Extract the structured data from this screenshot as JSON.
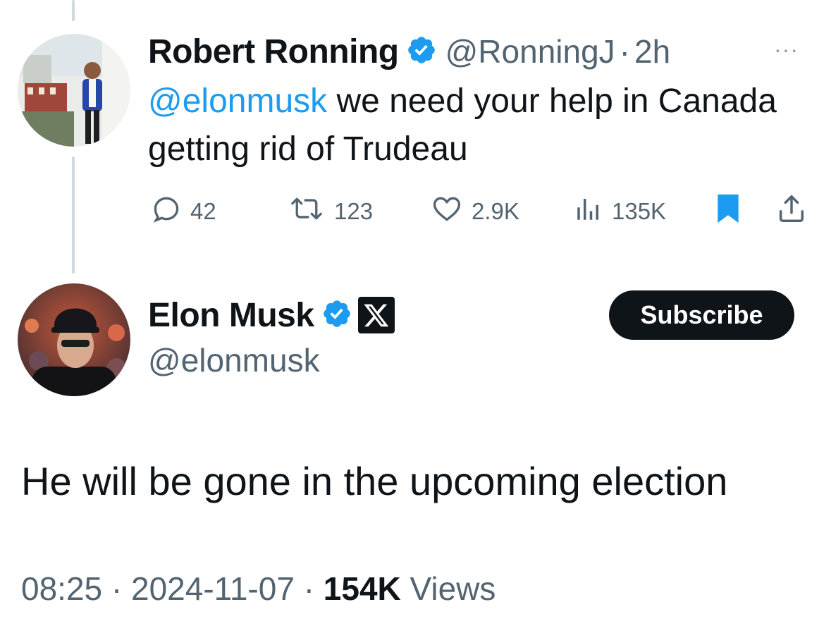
{
  "reply_tweet": {
    "author_name": "Robert Ronning",
    "handle": "@RonningJ",
    "separator": "·",
    "time": "2h",
    "more_label": "···",
    "mention": "@elonmusk",
    "text_after_mention": " we need your help in Canada getting rid of Trudeau",
    "stats": {
      "replies": "42",
      "reposts": "123",
      "likes": "2.9K",
      "views": "135K"
    },
    "bookmarked": true
  },
  "main_tweet": {
    "author_name": "Elon Musk",
    "handle": "@elonmusk",
    "subscribe_label": "Subscribe",
    "text": "He will be gone in the upcoming election",
    "time": "08:25",
    "separator": "·",
    "date": "2024-11-07",
    "views_count": "154K",
    "views_label": " Views"
  },
  "colors": {
    "accent": "#1d9bf0",
    "text_primary": "#0f1419",
    "text_secondary": "#536471",
    "thread_line": "#cfd9de"
  },
  "icons": [
    "verified-badge-icon",
    "x-logo-icon",
    "reply-icon",
    "repost-icon",
    "like-icon",
    "views-icon",
    "bookmark-icon",
    "share-icon"
  ]
}
